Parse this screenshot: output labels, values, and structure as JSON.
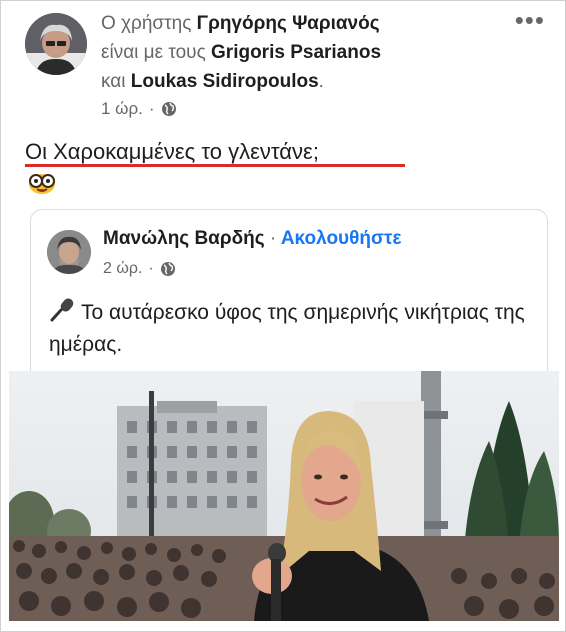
{
  "post": {
    "prefix": "Ο χρήστης",
    "author": "Γρηγόρης Ψαριανός",
    "with_text": "είναι με τους",
    "tagged_1": "Grigoris Psarianos",
    "and_text": "και",
    "tagged_2": "Loukas Sidiropoulos",
    "end_punct": ".",
    "time": "1 ώρ.",
    "more_icon": "more-horizontal-icon",
    "text": "Οι Χαροκαμμένες το γλεντάνε;",
    "emoji": "nerd-glasses-emoji",
    "underline_color": "#d92b2b"
  },
  "shared": {
    "author": "Μανώλης Βαρδής",
    "separator": "·",
    "follow": "Ακολουθήστε",
    "time": "2 ώρ.",
    "text": "Το αυτάρεσκο ύφος της σημερινής νικήτριας της ημέρας.",
    "icon": "microphone-icon",
    "follow_color": "#1877f2"
  }
}
